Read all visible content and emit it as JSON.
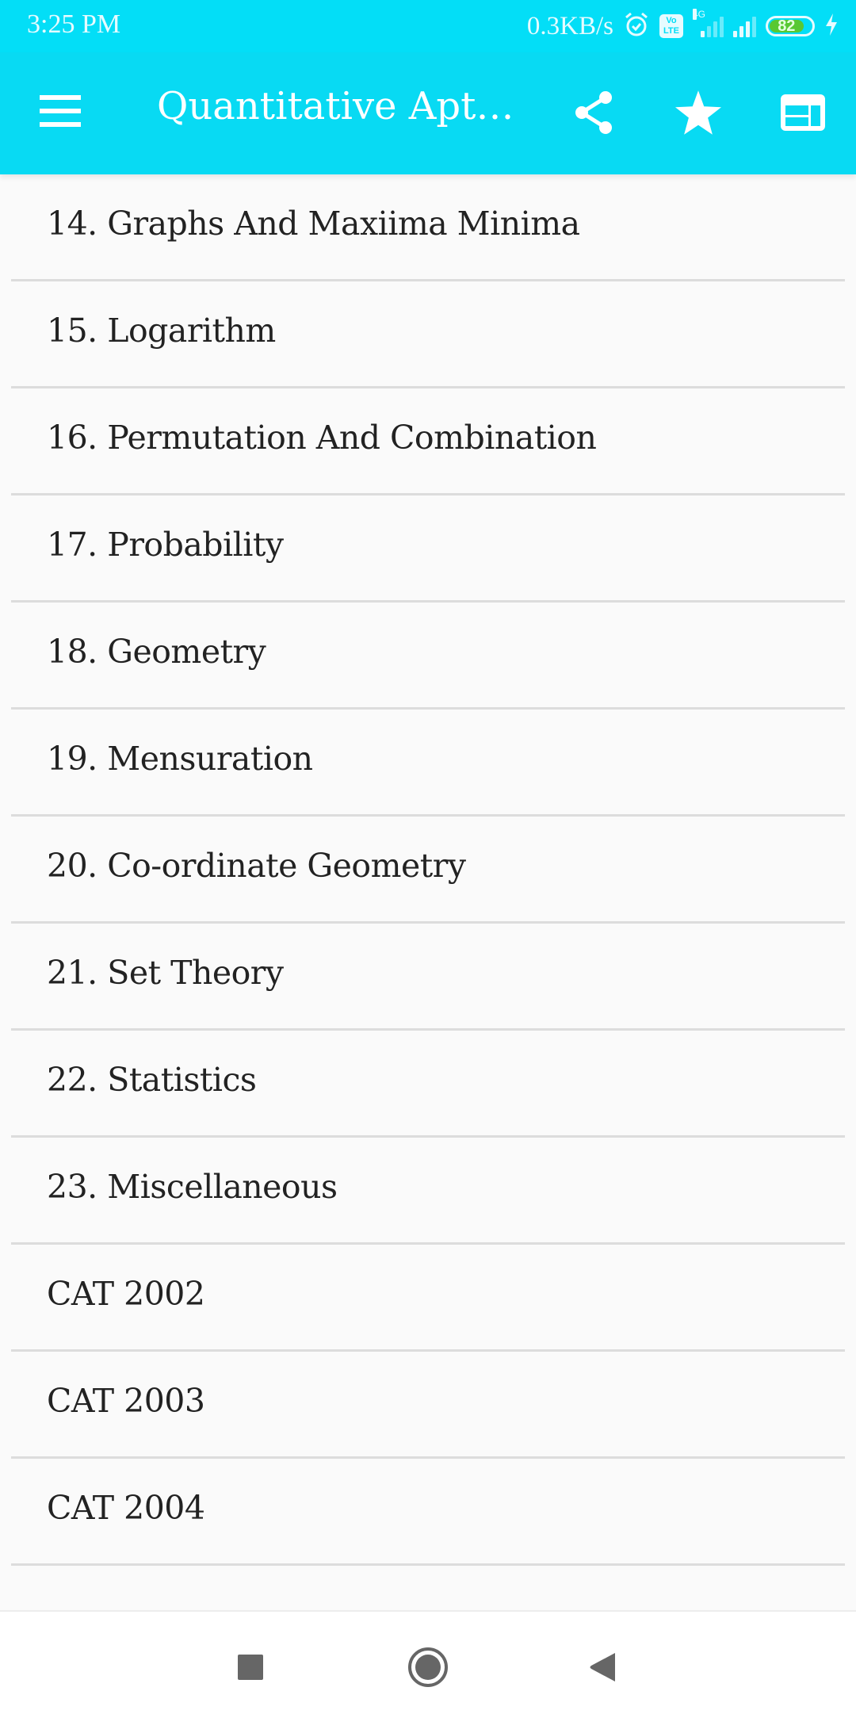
{
  "status_bar": {
    "time": "3:25 PM",
    "net_speed": "0.3KB/s",
    "volte_top": "Vo",
    "volte_bottom": "LTE",
    "network_type": "4G",
    "battery_level": "82",
    "icons": [
      "alarm-icon",
      "volte-icon",
      "signal-icon",
      "signal-icon",
      "battery-icon",
      "charging-icon"
    ]
  },
  "app_bar": {
    "title": "Quantitative Apt…",
    "menu_icon": "hamburger-menu-icon",
    "actions": [
      {
        "name": "share",
        "icon": "share-icon"
      },
      {
        "name": "favorite",
        "icon": "star-icon"
      },
      {
        "name": "layout",
        "icon": "layout-icon"
      }
    ]
  },
  "list": {
    "items": [
      {
        "label": "14. Graphs And Maxiima Minima"
      },
      {
        "label": "15. Logarithm"
      },
      {
        "label": "16. Permutation And Combination"
      },
      {
        "label": "17. Probability"
      },
      {
        "label": "18. Geometry"
      },
      {
        "label": "19. Mensuration"
      },
      {
        "label": "20. Co-ordinate Geometry"
      },
      {
        "label": "21. Set Theory"
      },
      {
        "label": "22. Statistics"
      },
      {
        "label": "23. Miscellaneous"
      },
      {
        "label": "CAT 2002"
      },
      {
        "label": "CAT 2003"
      },
      {
        "label": "CAT 2004"
      }
    ]
  },
  "nav_bar": {
    "buttons": [
      {
        "name": "recents",
        "icon": "square-icon"
      },
      {
        "name": "home",
        "icon": "circle-icon"
      },
      {
        "name": "back",
        "icon": "triangle-back-icon"
      }
    ]
  },
  "colors": {
    "status_bar": "#03def7",
    "app_bar": "#08daf3",
    "background": "#fafafa",
    "text": "#222222",
    "divider": "#dcdcdc",
    "battery_fill": "#58c832",
    "nav_icon": "#666666"
  }
}
